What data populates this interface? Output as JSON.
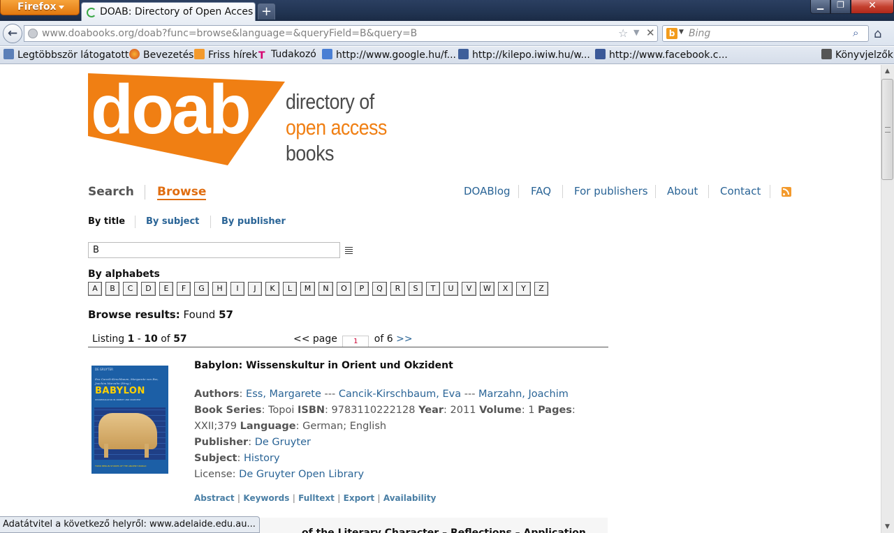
{
  "browser": {
    "app_button": "Firefox",
    "tab_title": "DOAB: Directory of Open Acces...",
    "new_tab": "+",
    "url_domain": "www.doabooks.org",
    "url_path": "/doab?func=browse&language=&queryField=B&query=B",
    "search_placeholder": "Bing",
    "status_text": "Adatátvitel a következő helyről: www.adelaide.edu.au..."
  },
  "bookmarks": [
    {
      "label": "Legtöbbször látogatott",
      "icon": "most-visited-icon"
    },
    {
      "label": "Bevezetés",
      "icon": "firefox-icon"
    },
    {
      "label": "Friss hírek",
      "icon": "rss-feed-icon"
    },
    {
      "label": "Tudakozó",
      "icon": "telekom-icon"
    },
    {
      "label": "http://www.google.hu/f...",
      "icon": "google-icon"
    },
    {
      "label": "http://kilepo.iwiw.hu/w...",
      "icon": "iwiw-icon"
    },
    {
      "label": "http://www.facebook.c...",
      "icon": "facebook-icon"
    },
    {
      "label": "Könyvjelzők",
      "icon": "bookmarks-star-icon"
    }
  ],
  "logo": {
    "wordmark": "doab",
    "line1": "directory of",
    "line2": "open access",
    "line3": "books",
    "brand_color": "#f07f13"
  },
  "nav": {
    "search": "Search",
    "browse": "Browse",
    "top_links": [
      "DOABlog",
      "FAQ",
      "For publishers",
      "About",
      "Contact"
    ]
  },
  "subnav": {
    "by_title": "By title",
    "by_subject": "By subject",
    "by_publisher": "By publisher"
  },
  "query": {
    "value": "B"
  },
  "alphabets": {
    "heading": "By alphabets",
    "letters": [
      "A",
      "B",
      "C",
      "D",
      "E",
      "F",
      "G",
      "H",
      "I",
      "J",
      "K",
      "L",
      "M",
      "N",
      "O",
      "P",
      "Q",
      "R",
      "S",
      "T",
      "U",
      "V",
      "W",
      "X",
      "Y",
      "Z"
    ]
  },
  "results": {
    "label": "Browse results:",
    "found_label": "Found",
    "found": "57",
    "listing_label": "Listing",
    "from": "1",
    "dash": "-",
    "to": "10",
    "of_label": "of",
    "total": "57",
    "prev": "<<",
    "page_label": "page",
    "page": "1",
    "of_pages_label": "of 6",
    "next": ">>"
  },
  "book": {
    "title": "Babylon: Wissenskultur in Orient und Okzident",
    "cover": {
      "publisher": "DE GRUYTER",
      "editors": "Eva Cancik-Kirschbaum, Margarete van Ess, Joachim Marzahn (Hrsg.)",
      "title": "BABYLON",
      "subtitle": "WISSENSKULTUR IN ORIENT UND OKZIDENT",
      "series": "TOPOI BERLIN STUDIES OF THE ANCIENT WORLD"
    },
    "authors_label": "Authors",
    "authors": [
      "Ess, Margarete",
      "Cancik-Kirschbaum, Eva",
      "Marzahn, Joachim"
    ],
    "author_sep": " --- ",
    "series_label": "Book Series",
    "series": "Topoi",
    "isbn_label": "ISBN",
    "isbn": "9783110222128",
    "year_label": "Year",
    "year": "2011",
    "volume_label": "Volume",
    "volume": "1",
    "pages_label": "Pages",
    "pages": "XXII;379",
    "language_label": "Language",
    "language": "German; English",
    "publisher_label": "Publisher",
    "publisher": "De Gruyter",
    "subject_label": "Subject",
    "subject": "History",
    "license_label": "License:",
    "license": "De Gruyter Open Library",
    "actions": [
      "Abstract",
      "Keywords",
      "Fulltext",
      "Export",
      "Availability"
    ]
  },
  "next_book_partial": "of the Literary Character – Reflections – Application"
}
